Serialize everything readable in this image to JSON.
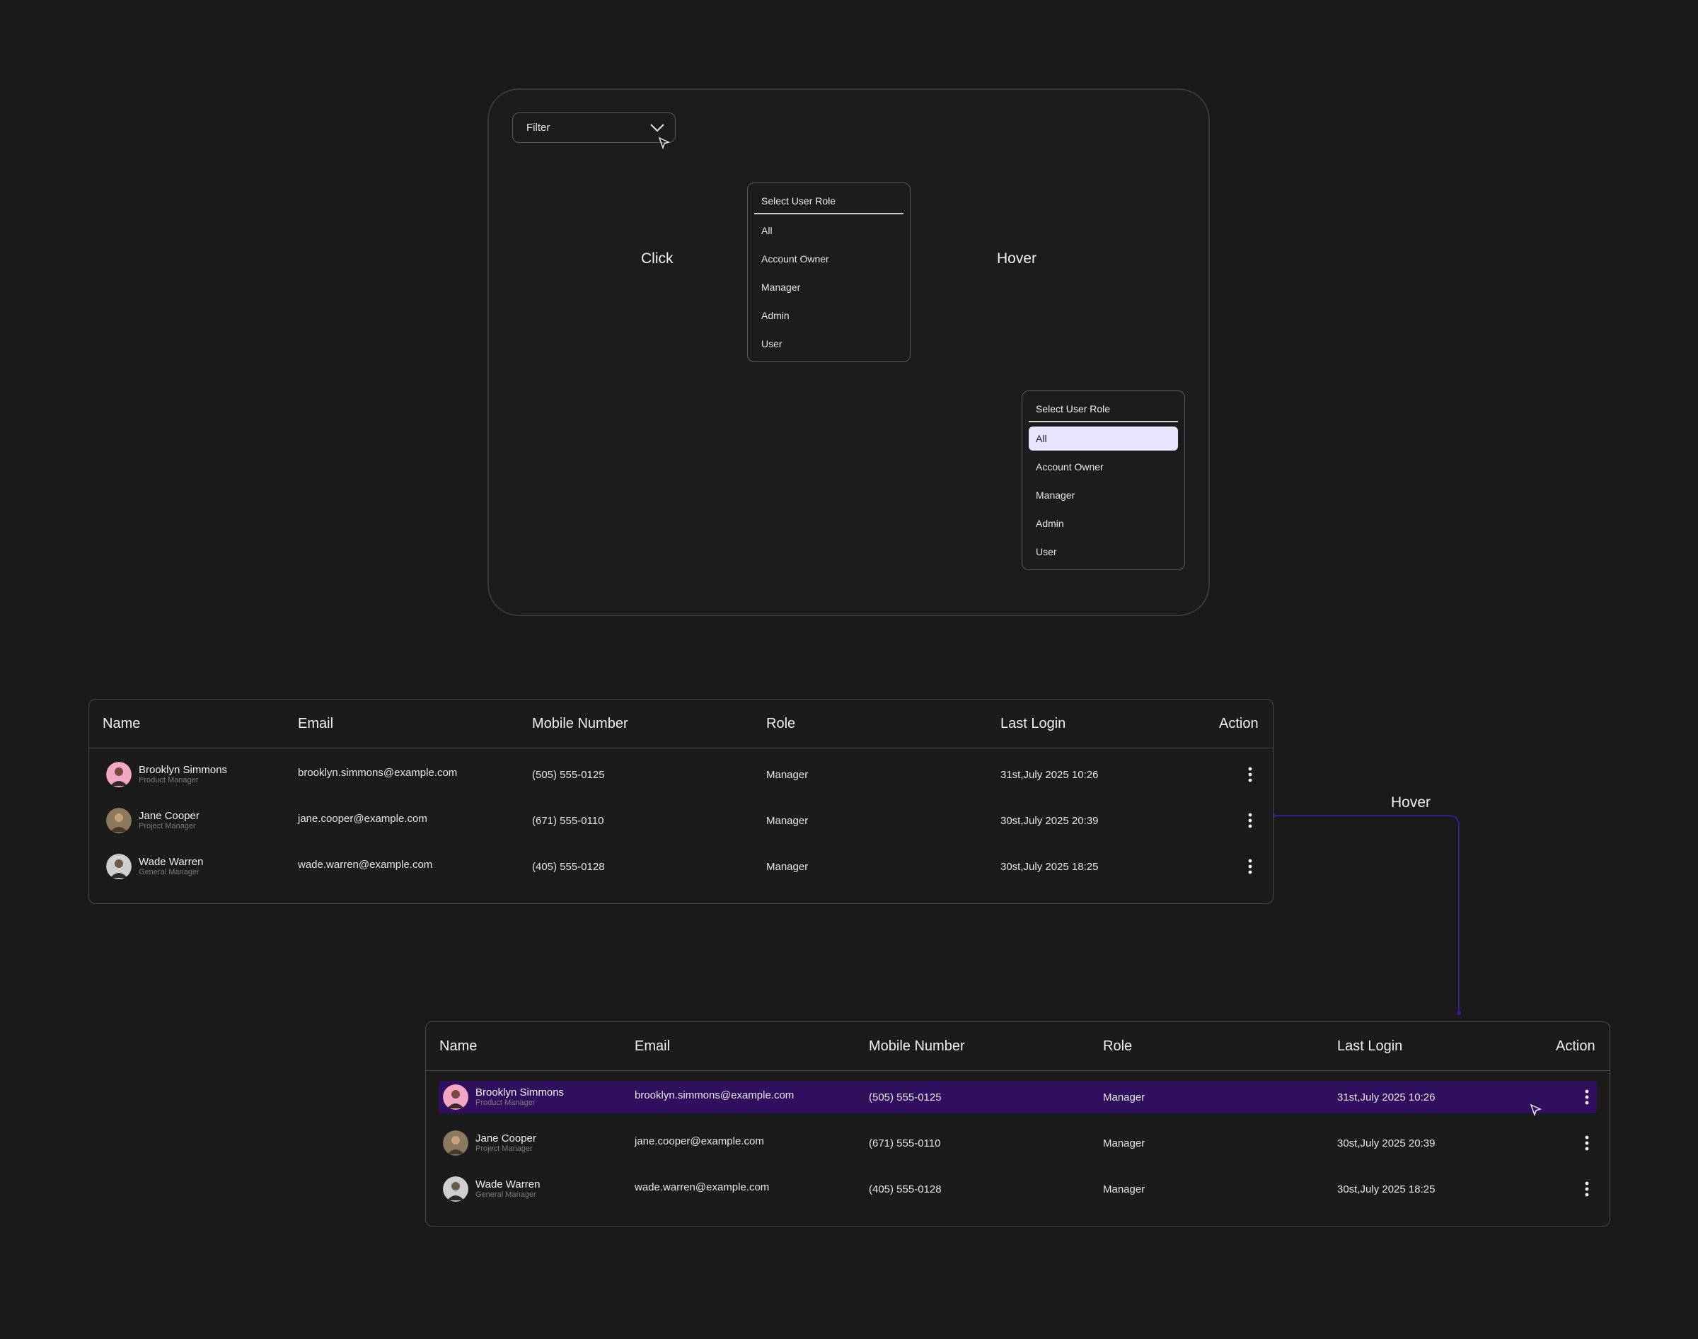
{
  "filter": {
    "label": "Filter",
    "icon": "chevron-down-icon"
  },
  "role_menu": {
    "title": "Select User Role",
    "options": [
      "All",
      "Account Owner",
      "Manager",
      "Admin",
      "User"
    ]
  },
  "role_menu_hover": {
    "title": "Select User Role",
    "options": [
      "All",
      "Account Owner",
      "Manager",
      "Admin",
      "User"
    ],
    "highlighted": "All"
  },
  "flow_labels": {
    "click": "Click",
    "hover": "Hover",
    "row_hover": "Hover"
  },
  "table": {
    "columns": [
      "Name",
      "Email",
      "Mobile Number",
      "Role",
      "Last Login",
      "Action"
    ],
    "rows": [
      {
        "name": "Brooklyn Simmons",
        "title": "Product Manager",
        "email": "brooklyn.simmons@example.com",
        "mobile": "(505) 555-0125",
        "role": "Manager",
        "last_login": "31st,July 2025 10:26"
      },
      {
        "name": "Jane Cooper",
        "title": "Project Manager",
        "email": "jane.cooper@example.com",
        "mobile": "(671) 555-0110",
        "role": "Manager",
        "last_login": "30st,July 2025 20:39"
      },
      {
        "name": "Wade Warren",
        "title": "General Manager",
        "email": "wade.warren@example.com",
        "mobile": "(405) 555-0128",
        "role": "Manager",
        "last_login": "30st,July 2025 18:25"
      }
    ]
  },
  "table_hover": {
    "columns": [
      "Name",
      "Email",
      "Mobile Number",
      "Role",
      "Last Login",
      "Action"
    ],
    "highlighted_row": "Brooklyn Simmons",
    "rows": [
      {
        "name": "Brooklyn Simmons",
        "title": "Product Manager",
        "email": "brooklyn.simmons@example.com",
        "mobile": "(505) 555-0125",
        "role": "Manager",
        "last_login": "31st,July 2025 10:26"
      },
      {
        "name": "Jane Cooper",
        "title": "Project Manager",
        "email": "jane.cooper@example.com",
        "mobile": "(671) 555-0110",
        "role": "Manager",
        "last_login": "30st,July 2025 20:39"
      },
      {
        "name": "Wade Warren",
        "title": "General Manager",
        "email": "wade.warren@example.com",
        "mobile": "(405) 555-0128",
        "role": "Manager",
        "last_login": "30st,July 2025 18:25"
      }
    ]
  },
  "colors": {
    "background": "#1a1a1a",
    "flow_line": "#3d1a8a",
    "row_highlight": "#30105e",
    "option_highlight": "#e9e4ff"
  }
}
